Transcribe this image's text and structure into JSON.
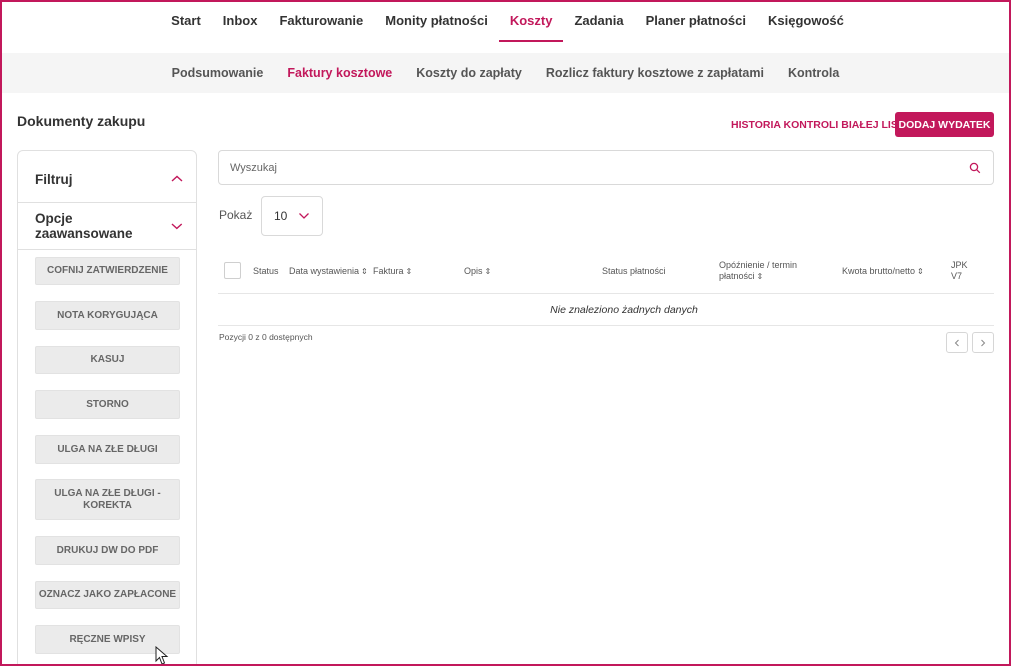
{
  "top_nav": {
    "items": [
      "Start",
      "Inbox",
      "Fakturowanie",
      "Monity płatności",
      "Koszty",
      "Zadania",
      "Planer płatności",
      "Księgowość"
    ],
    "active": "Koszty"
  },
  "sub_nav": {
    "items": [
      "Podsumowanie",
      "Faktury kosztowe",
      "Koszty do zapłaty",
      "Rozlicz faktury kosztowe z zapłatami",
      "Kontrola"
    ],
    "active": "Faktury kosztowe"
  },
  "page": {
    "title": "Dokumenty zakupu",
    "history_link": "HISTORIA KONTROLI BIAŁEJ LISTY",
    "add_button": "DODAJ WYDATEK"
  },
  "sidebar": {
    "filter_label": "Filtruj",
    "advanced_label": "Opcje zaawansowane",
    "buttons": [
      "COFNIJ ZATWIERDZENIE",
      "NOTA KORYGUJĄCA",
      "KASUJ",
      "STORNO",
      "ULGA NA ZŁE DŁUGI",
      "ULGA NA ZŁE DŁUGI - KOREKTA",
      "DRUKUJ DW DO PDF",
      "OZNACZ JAKO ZAPŁACONE",
      "RĘCZNE WPISY"
    ]
  },
  "search": {
    "placeholder": "Wyszukaj",
    "value": ""
  },
  "page_size": {
    "label": "Pokaż",
    "value": "10"
  },
  "table": {
    "columns": {
      "status": "Status",
      "date": "Data wystawienia",
      "invoice": "Faktura",
      "description": "Opis",
      "payment_status": "Status płatności",
      "delay_line1": "Opóźnienie / termin",
      "delay_line2": "płatności",
      "amount": "Kwota brutto/netto",
      "jpk_line1": "JPK",
      "jpk_line2": "V7"
    },
    "sort_glyph": "⇕",
    "empty_message": "Nie znaleziono żadnych danych",
    "position_info": "Pozycji 0 z 0 dostępnych"
  },
  "colors": {
    "accent": "#c2185b",
    "subnav_bg": "#f5f5f5",
    "button_bg": "#ebebeb"
  },
  "icons": [
    "chevron-up-icon",
    "chevron-down-icon",
    "search-icon",
    "chevron-left-icon",
    "chevron-right-icon",
    "mouse-cursor-icon"
  ]
}
